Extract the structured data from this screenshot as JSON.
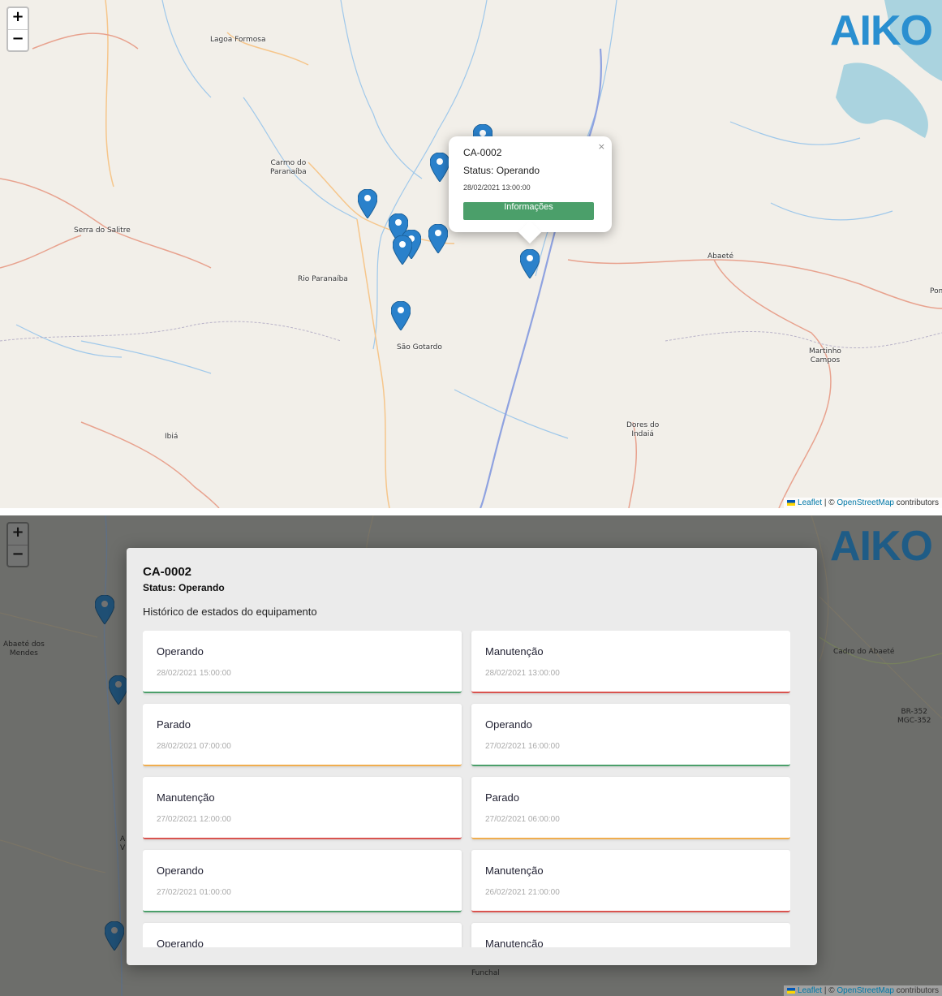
{
  "logo_text": "AIKO",
  "zoom": {
    "in_label": "+",
    "out_label": "−"
  },
  "attribution": {
    "leaflet": "Leaflet",
    "sep": " | © ",
    "osm": "OpenStreetMap",
    "contrib": " contributors"
  },
  "top_map": {
    "places": [
      {
        "name": "Lagoa Formosa",
        "key": "lagoa-formosa"
      },
      {
        "name": "Carmo do\nParanaíba",
        "key": "carmo-do-paranaiba"
      },
      {
        "name": "Serra do Salitre",
        "key": "serra-do-salitre"
      },
      {
        "name": "Rio Paranaíba",
        "key": "rio-paranaiba"
      },
      {
        "name": "São Gotardo",
        "key": "sao-gotardo"
      },
      {
        "name": "Abaeté",
        "key": "abaete"
      },
      {
        "name": "Martinho\nCampos",
        "key": "martinho-campos"
      },
      {
        "name": "Dores do\nIndaiá",
        "key": "dores-do-indaia"
      },
      {
        "name": "Ibiá",
        "key": "ibia"
      },
      {
        "name": "Pom",
        "key": "pom"
      }
    ],
    "popup": {
      "code": "CA-0002",
      "status": "Status: Operando",
      "date": "28/02/2021 13:00:00",
      "button": "Informações",
      "close": "×"
    }
  },
  "bottom_map": {
    "places": [
      {
        "name": "Abaeté dos\nMendes",
        "key": "abaete-dos-mendes"
      },
      {
        "name": "Cadro do Abaeté",
        "key": "cadro-do-abaete"
      },
      {
        "name": "BR-352\nMGC-352",
        "key": "br-352"
      },
      {
        "name": "Funchal",
        "key": "funchal"
      },
      {
        "name": "A\nV",
        "key": "partial-label"
      }
    ]
  },
  "modal": {
    "code": "CA-0002",
    "status": "Status: Operando",
    "subtitle": "Histórico de estados do equipamento",
    "history": [
      {
        "state": "Operando",
        "time": "28/02/2021 15:00:00",
        "color": "#4b9f6a"
      },
      {
        "state": "Manutenção",
        "time": "28/02/2021 13:00:00",
        "color": "#d9534f"
      },
      {
        "state": "Parado",
        "time": "28/02/2021 07:00:00",
        "color": "#f0ad4e"
      },
      {
        "state": "Operando",
        "time": "27/02/2021 16:00:00",
        "color": "#4b9f6a"
      },
      {
        "state": "Manutenção",
        "time": "27/02/2021 12:00:00",
        "color": "#d9534f"
      },
      {
        "state": "Parado",
        "time": "27/02/2021 06:00:00",
        "color": "#f0ad4e"
      },
      {
        "state": "Operando",
        "time": "27/02/2021 01:00:00",
        "color": "#4b9f6a"
      },
      {
        "state": "Manutenção",
        "time": "26/02/2021 21:00:00",
        "color": "#d9534f"
      },
      {
        "state": "Operando",
        "time": "",
        "color": "#4b9f6a"
      },
      {
        "state": "Manutenção",
        "time": "",
        "color": "#d9534f"
      }
    ]
  },
  "colors": {
    "marker": "#2a81cb",
    "button_green": "#4b9f6a",
    "logo_blue": "#2a8fd0"
  }
}
